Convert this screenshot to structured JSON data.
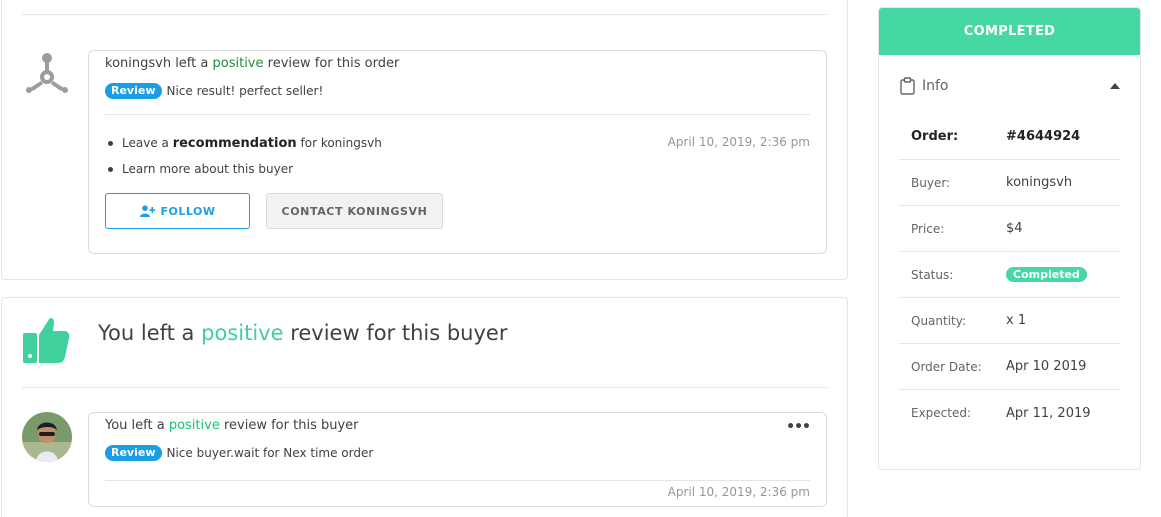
{
  "activity": {
    "buyer_review": {
      "prefix": "koningsvh left a",
      "highlight": "positive",
      "suffix": "review for this order",
      "badge": "Review",
      "text": "Nice result! perfect seller!",
      "bullets": [
        {
          "pre": "Leave a",
          "bold": "recommendation",
          "post": "for koningsvh"
        },
        {
          "text": "Learn more about this buyer"
        }
      ],
      "timestamp": "April 10, 2019, 2:36 pm",
      "follow_label": "FOLLOW",
      "contact_label": "CONTACT KONINGSVH"
    },
    "seller_section": {
      "title_pre": "You left a",
      "title_highlight": "positive",
      "title_post": "review for this buyer"
    },
    "seller_review": {
      "prefix": "You left a",
      "highlight": "positive",
      "suffix": "review for this buyer",
      "badge": "Review",
      "text": "Nice buyer.wait for Nex time order",
      "timestamp": "April 10, 2019, 2:36 pm",
      "menu_icon": "more-dots-icon"
    }
  },
  "sidebar": {
    "status": "COMPLETED",
    "info_label": "Info",
    "icons": {
      "info": "clipboard-icon",
      "collapse": "caret-up-icon"
    },
    "rows": {
      "order": {
        "key": "Order:",
        "value": "#4644924"
      },
      "buyer": {
        "key": "Buyer:",
        "value": "koningsvh"
      },
      "price": {
        "key": "Price:",
        "value": "$4"
      },
      "status": {
        "key": "Status:",
        "value": "Completed"
      },
      "quantity": {
        "key": "Quantity:",
        "value": "x 1"
      },
      "order_date": {
        "key": "Order Date:",
        "value": "Apr 10 2019"
      },
      "expected": {
        "key": "Expected:",
        "value": "Apr 11, 2019"
      }
    }
  },
  "colors": {
    "accent_green": "#45d8a3",
    "review_blue": "#1a9ee6",
    "positive_dark": "#1f8a3d"
  }
}
